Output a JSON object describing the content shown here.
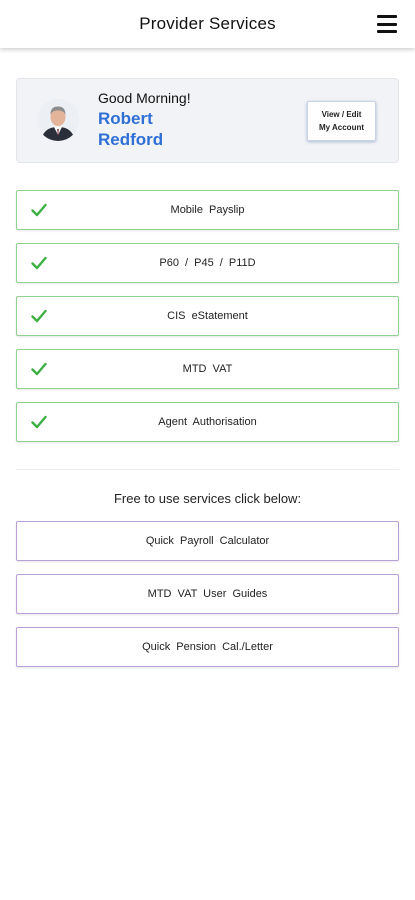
{
  "header": {
    "title": "Provider Services",
    "menu_icon": "hamburger-menu-icon"
  },
  "profile": {
    "greeting": "Good Morning!",
    "first_name": "Robert",
    "last_name": "Redford",
    "account_button_line1": "View / Edit",
    "account_button_line2": "My Account",
    "name_color": "#2f6fd6"
  },
  "services": [
    {
      "label": "Mobile Payslip",
      "icon": "check-icon",
      "enabled": true
    },
    {
      "label": "P60 / P45 / P11D",
      "icon": "check-icon",
      "enabled": true
    },
    {
      "label": "CIS eStatement",
      "icon": "check-icon",
      "enabled": true
    },
    {
      "label": "MTD VAT",
      "icon": "check-icon",
      "enabled": true
    },
    {
      "label": "Agent Authorisation",
      "icon": "check-icon",
      "enabled": true
    }
  ],
  "free_section": {
    "heading": "Free to use services click below:",
    "items": [
      {
        "label": "Quick Payroll Calculator"
      },
      {
        "label": "MTD VAT User Guides"
      },
      {
        "label": "Quick Pension Cal./Letter"
      }
    ]
  },
  "colors": {
    "service_border": "#8fd18f",
    "check_green": "#3cb043",
    "free_border": "#b9a0d8"
  }
}
